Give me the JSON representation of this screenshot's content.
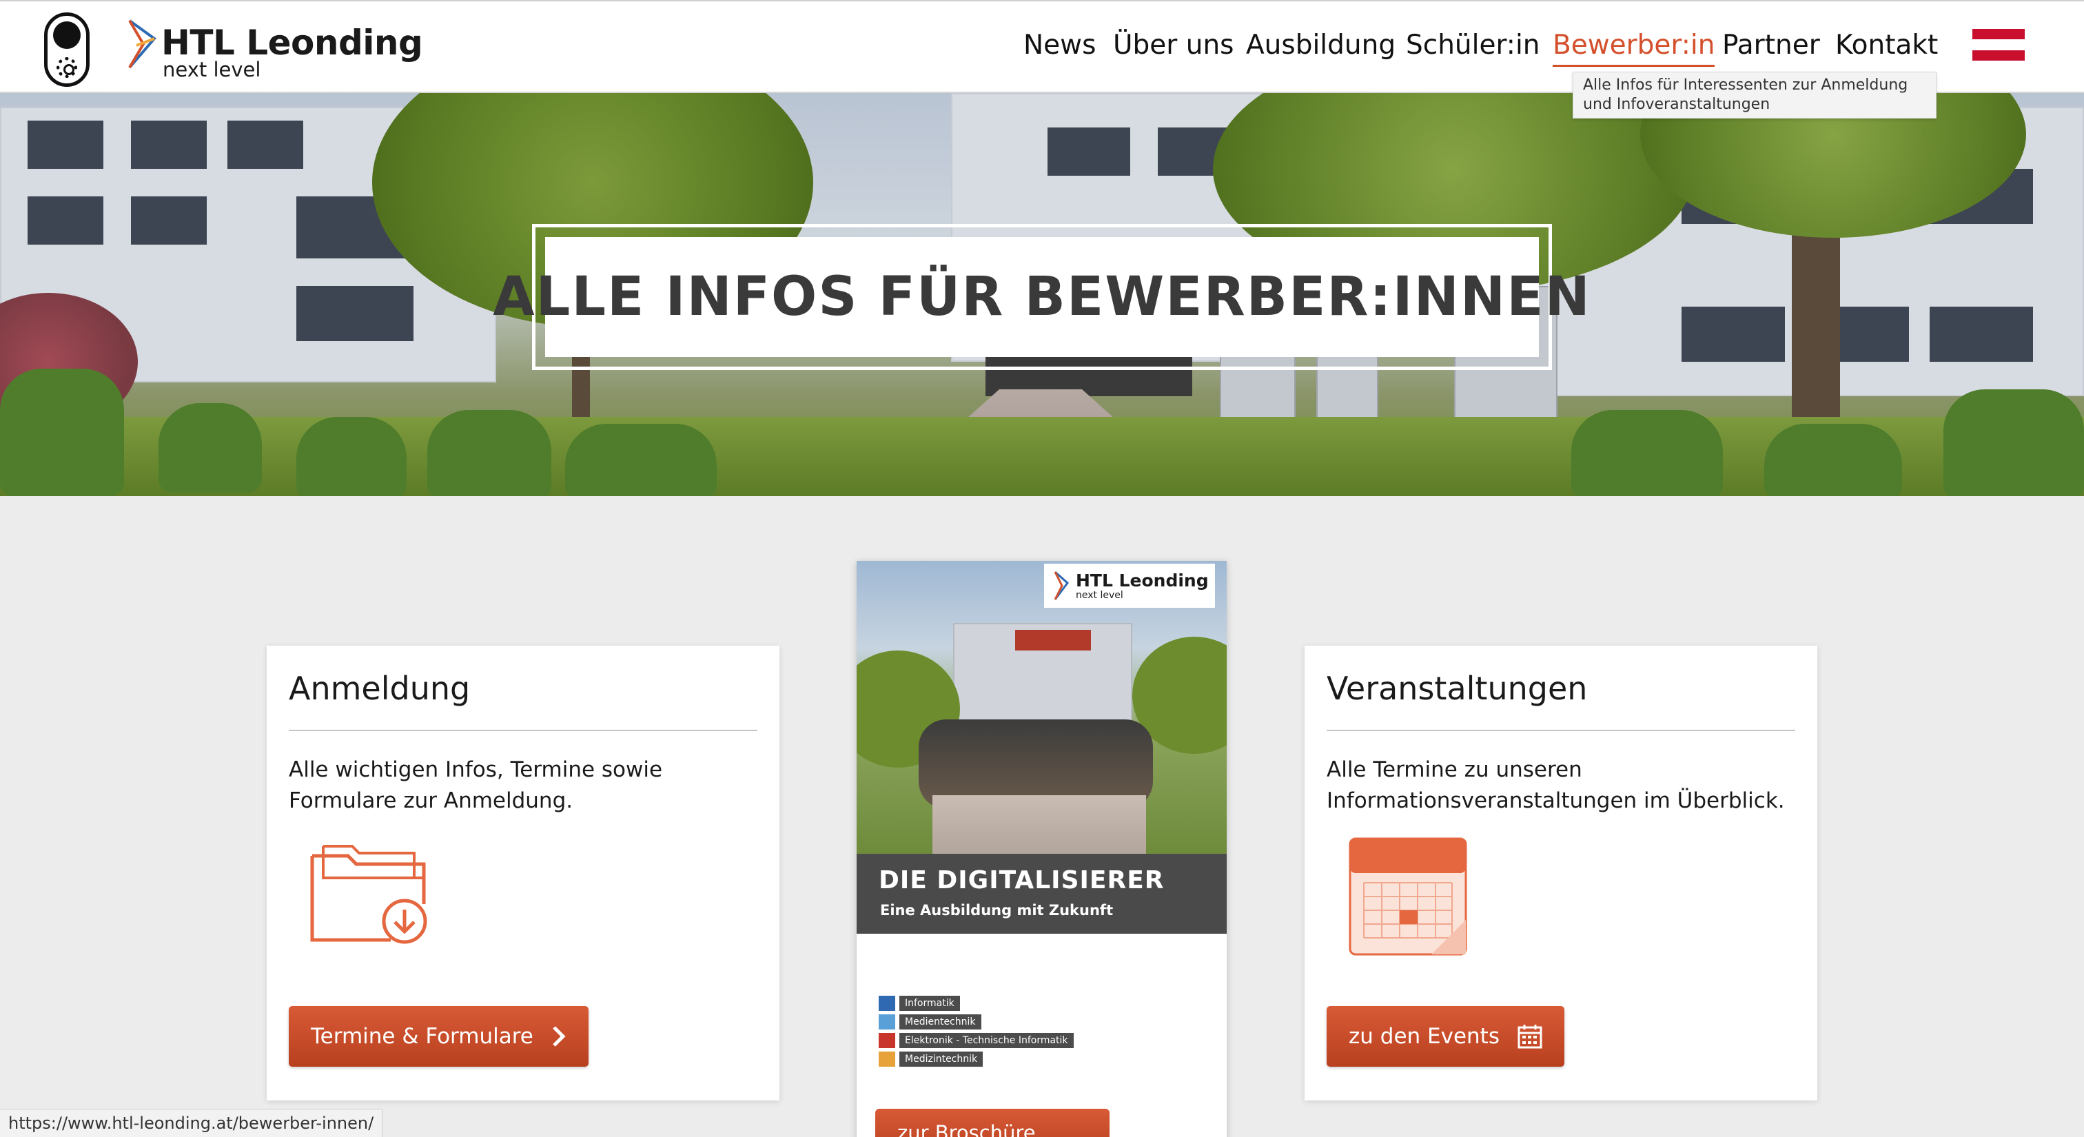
{
  "header": {
    "brand_name": "HTL Leonding",
    "brand_tagline": "next level",
    "nav": [
      "News",
      "Über uns",
      "Ausbildung",
      "Schüler:in",
      "Bewerber:in",
      "Partner",
      "Kontakt"
    ],
    "active_nav": "Bewerber:in",
    "tooltip": "Alle Infos für Interessenten zur Anmeldung und Infoveranstaltungen",
    "flag_colors": [
      "#c8102e",
      "#ffffff",
      "#c8102e"
    ]
  },
  "hero": {
    "title": "ALLE INFOS FÜR BEWERBER:INNEN"
  },
  "cards": {
    "anmeldung": {
      "title": "Anmeldung",
      "text": "Alle wichtigen Infos, Termine sowie Formulare zur Anmeldung.",
      "icon": "folder-download-icon",
      "button_label": "Termine & Formulare"
    },
    "veranstaltungen": {
      "title": "Veranstaltungen",
      "text": "Alle Termine zu unseren Informationsveranstaltungen im Überblick.",
      "icon": "calendar-icon",
      "button_label": "zu den Events"
    }
  },
  "brochure": {
    "logo_name": "HTL Leonding",
    "logo_tagline": "next level",
    "headline": "DIE DIGITALISIERER",
    "subline": "Eine Ausbildung mit Zukunft",
    "departments": [
      "Informatik",
      "Medientechnik",
      "Elektronik - Technische Informatik",
      "Medizintechnik"
    ],
    "button_label": "zur Broschüre"
  },
  "status_url": "https://www.htl-leonding.at/bewerber-innen/",
  "colors": {
    "accent": "#d4502c",
    "button": "#c64b28",
    "page_bg": "#ececec"
  }
}
